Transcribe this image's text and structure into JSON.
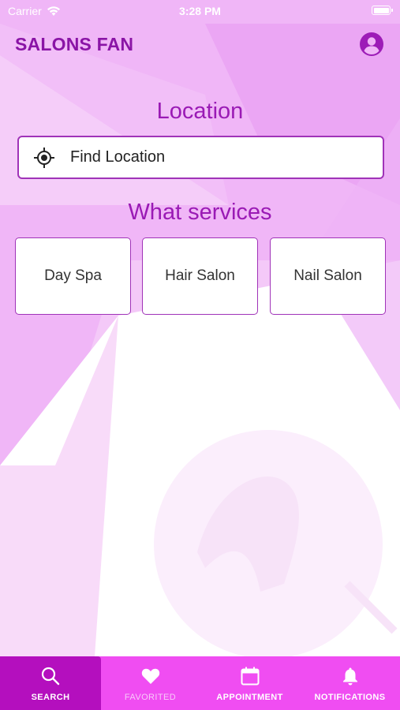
{
  "status_bar": {
    "carrier": "Carrier",
    "time": "3:28 PM"
  },
  "header": {
    "app_title": "SALONS FAN",
    "profile_icon": "account-circle-icon"
  },
  "location": {
    "title": "Location",
    "search_label": "Find Location",
    "icon": "gps-target-icon"
  },
  "services": {
    "title": "What services",
    "items": [
      {
        "label": "Day Spa"
      },
      {
        "label": "Hair Salon"
      },
      {
        "label": "Nail Salon"
      }
    ]
  },
  "tabbar": {
    "active": "SEARCH",
    "tabs": [
      {
        "label": "SEARCH",
        "icon": "search-icon"
      },
      {
        "label": "FAVORITED",
        "icon": "heart-icon"
      },
      {
        "label": "APPOINTMENT",
        "icon": "calendar-icon"
      },
      {
        "label": "NOTIFICATIONS",
        "icon": "bell-icon"
      }
    ]
  },
  "colors": {
    "brand_purple": "#8a14a6",
    "background_pink": "#f0b6f7",
    "tabbar": "#f04df2",
    "tab_active": "#b40fbe",
    "border": "#a033b8"
  }
}
